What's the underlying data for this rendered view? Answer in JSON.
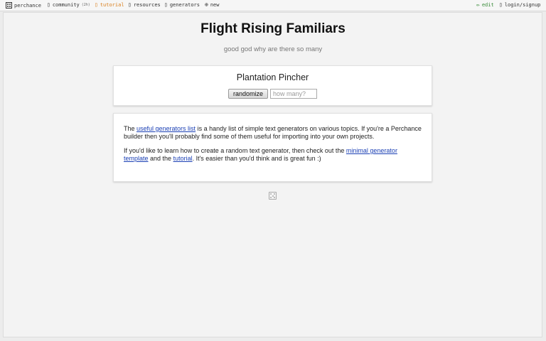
{
  "nav": {
    "logo_label": "perchance",
    "community_label": "community",
    "community_count": "(2h)",
    "tutorial_label": "tutorial",
    "resources_label": "resources",
    "generators_label": "generators",
    "new_label": "new",
    "edit_label": "edit",
    "login_label": "login/signup"
  },
  "page": {
    "title": "Flight Rising Familiars",
    "subtitle": "good god why are there so many"
  },
  "output": {
    "text": "Plantation Pincher",
    "randomize_label": "randomize",
    "count_placeholder": "how many?"
  },
  "info": {
    "p1_before": "The ",
    "p1_link": "useful generators list",
    "p1_after": " is a handy list of simple text generators on various topics. If you're a Perchance builder then you'll probably find some of them useful for importing into your own projects.",
    "p2_before": "If you'd like to learn how to create a random text generator, then check out the ",
    "p2_link1": "minimal generator template",
    "p2_mid": " and the ",
    "p2_link2": "tutorial",
    "p2_after": ". It's easier than you'd think and is great fun :)"
  },
  "colors": {
    "tutorial": "#d97f1d",
    "edit": "#3a8c3a",
    "link": "#1a3fb4"
  }
}
